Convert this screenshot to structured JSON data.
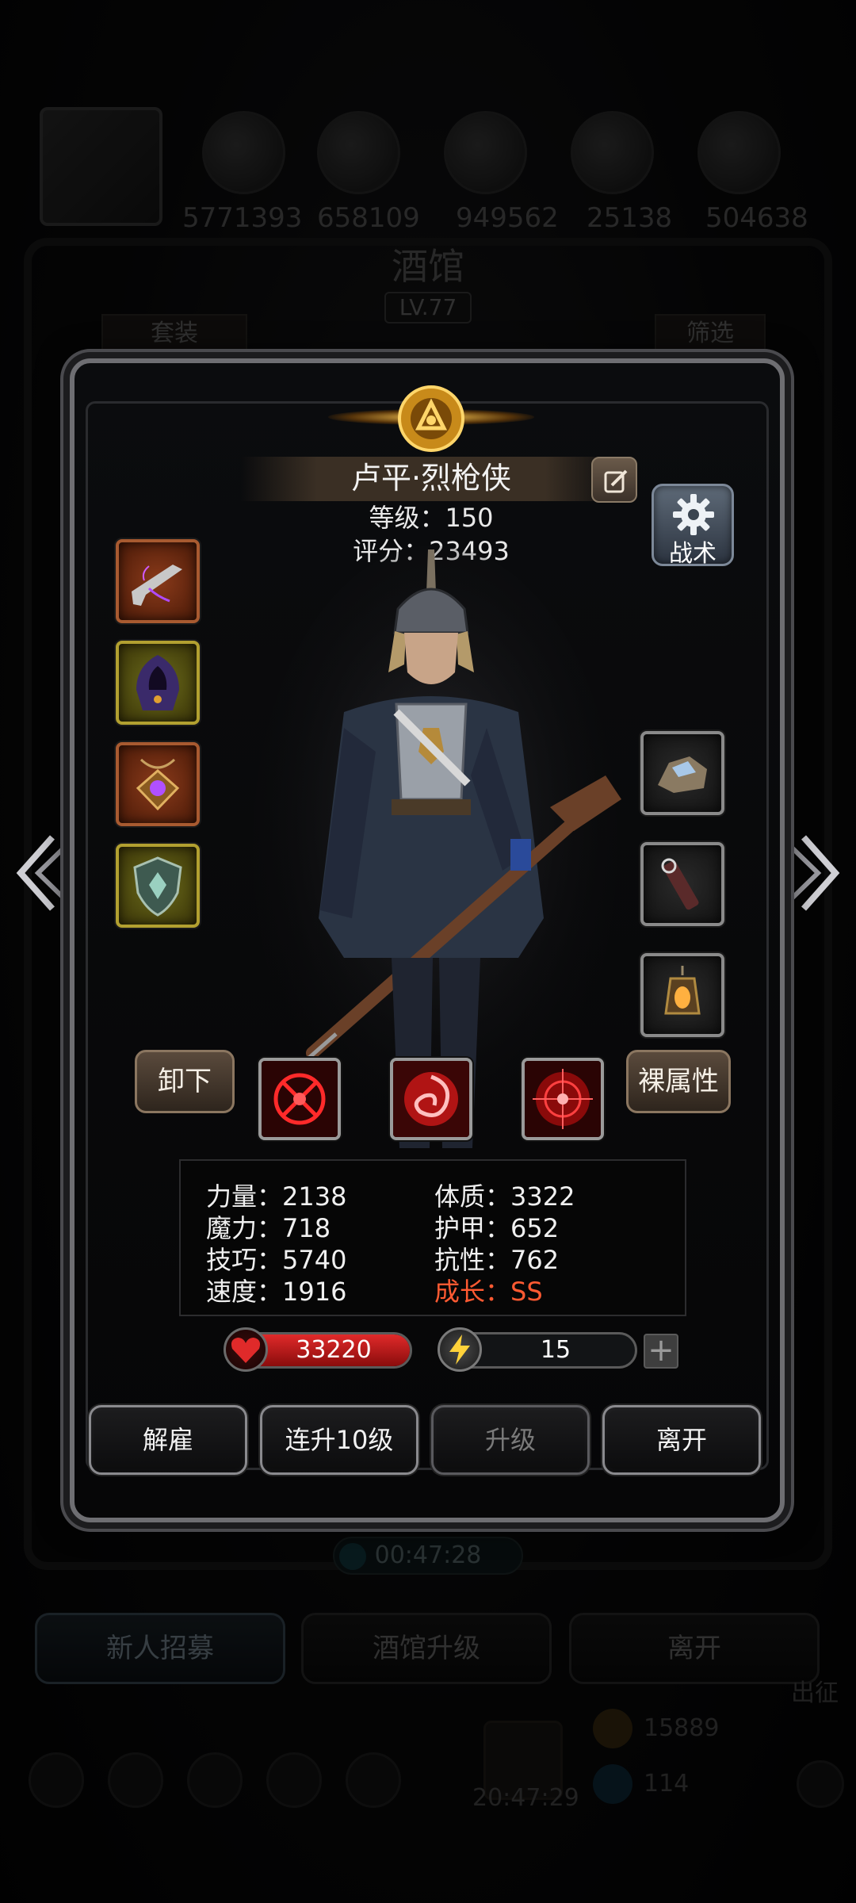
{
  "background": {
    "resources": [
      "5771393",
      "658109",
      "949562",
      "25138",
      "504638"
    ],
    "title": "酒馆",
    "level": "LV.77",
    "tabs": {
      "left": "套装",
      "right": "筛选"
    },
    "timer": "00:47:28",
    "buttons": [
      "新人招募",
      "酒馆升级",
      "离开"
    ],
    "chest_timer": "20:47:29",
    "coins": "15889",
    "gems": "114",
    "expedition": "出征"
  },
  "hero": {
    "name": "卢平·烈枪侠",
    "level_line": "等级：150",
    "score_line": "评分：23493",
    "tactic_label": "战术",
    "unequip_label": "卸下",
    "base_attr_label": "裸属性",
    "equipment_left": [
      {
        "icon": "flintlock-pistol-icon",
        "quality": "orange"
      },
      {
        "icon": "hooded-cloak-icon",
        "quality": "gold"
      },
      {
        "icon": "amulet-icon",
        "quality": "orange"
      },
      {
        "icon": "shield-emblem-icon",
        "quality": "gold"
      }
    ],
    "equipment_right": [
      {
        "icon": "ore-stone-icon",
        "quality": "gray"
      },
      {
        "icon": "scroll-charm-icon",
        "quality": "gray"
      },
      {
        "icon": "lantern-icon",
        "quality": "gray"
      }
    ],
    "skills": [
      "crosshair-skill-icon",
      "vortex-skill-icon",
      "target-skill-icon"
    ],
    "stats": {
      "strength": "力量：2138",
      "constitution": "体质：3322",
      "magic": "魔力：718",
      "armor": "护甲：652",
      "skill": "技巧：5740",
      "resistance": "抗性：762",
      "speed": "速度：1916",
      "growth": "成长：SS"
    },
    "hp": {
      "value": "33220",
      "fill_fraction": 1.0
    },
    "energy": {
      "value": "15",
      "fill_fraction": 0.15
    },
    "actions": {
      "dismiss": "解雇",
      "level_up_10": "连升10级",
      "upgrade": "升级",
      "leave": "离开"
    }
  },
  "colors": {
    "growth_text": "#ff5a32",
    "hp_fill": "#e02a2a",
    "energy_fill": "#ffe24a"
  }
}
